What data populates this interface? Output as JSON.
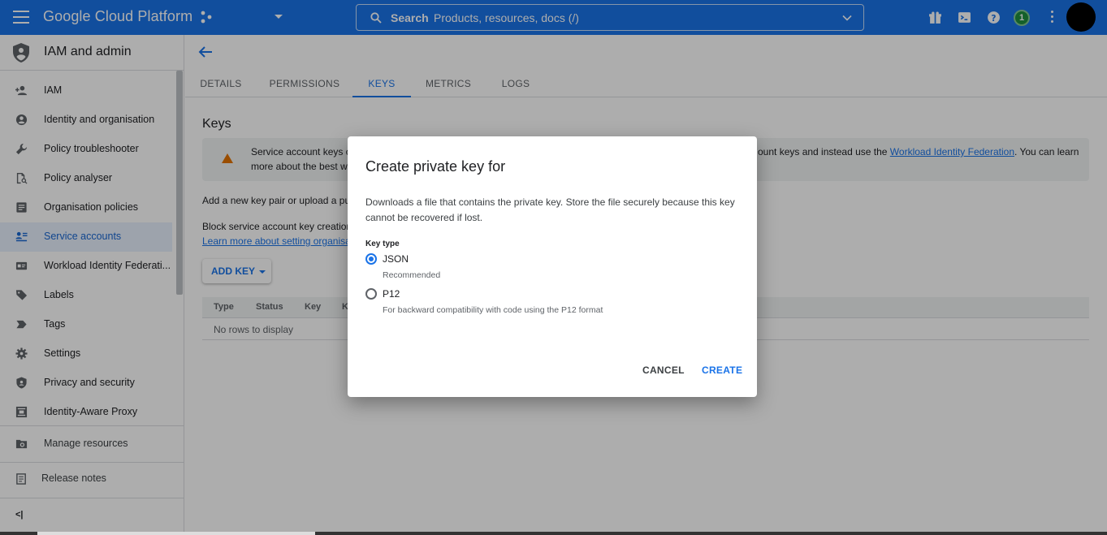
{
  "topbar": {
    "brand": "Google Cloud Platform",
    "search_label": "Search",
    "search_placeholder": "Products, resources, docs (/)",
    "notification_count": "1",
    "color": "#1a73e8"
  },
  "sidebar": {
    "title": "IAM and admin",
    "items": [
      {
        "label": "IAM",
        "icon": "person-add-icon"
      },
      {
        "label": "Identity and organisation",
        "icon": "account-circle-icon"
      },
      {
        "label": "Policy troubleshooter",
        "icon": "wrench-icon"
      },
      {
        "label": "Policy analyser",
        "icon": "document-search-icon"
      },
      {
        "label": "Organisation policies",
        "icon": "list-box-icon"
      },
      {
        "label": "Service accounts",
        "icon": "service-account-icon",
        "active": true
      },
      {
        "label": "Workload Identity Federati...",
        "icon": "id-card-icon"
      },
      {
        "label": "Labels",
        "icon": "label-icon"
      },
      {
        "label": "Tags",
        "icon": "tag-chevron-icon"
      },
      {
        "label": "Settings",
        "icon": "gear-icon"
      },
      {
        "label": "Privacy and security",
        "icon": "shield-icon"
      },
      {
        "label": "Identity-Aware Proxy",
        "icon": "proxy-icon"
      }
    ],
    "manage_resources": "Manage resources",
    "release_notes": "Release notes",
    "collapse": "<|"
  },
  "main": {
    "tabs": [
      {
        "label": "DETAILS"
      },
      {
        "label": "PERMISSIONS"
      },
      {
        "label": "KEYS",
        "active": true
      },
      {
        "label": "METRICS"
      },
      {
        "label": "LOGS"
      }
    ],
    "heading": "Keys",
    "warning_line1": "Service account keys c",
    "warning_line2": "more about the best wa",
    "warning_right_prefix": "ount keys and instead use the",
    "warning_link": "Workload Identity Federation",
    "warning_right_suffix": ". You can learn",
    "add_key_text": "Add a new key pair or upload a pub",
    "block_text": "Block service account key creation",
    "learn_link": "Learn more about setting organisa",
    "add_key_button": "ADD KEY",
    "table_headers": [
      "Type",
      "Status",
      "Key",
      "K"
    ],
    "empty_text": "No rows to display"
  },
  "dialog": {
    "title": "Create private key for",
    "description": "Downloads a file that contains the private key. Store the file securely because this key cannot be recovered if lost.",
    "key_type_label": "Key type",
    "options": [
      {
        "label": "JSON",
        "sub": "Recommended",
        "checked": true
      },
      {
        "label": "P12",
        "sub": "For backward compatibility with code using the P12 format",
        "checked": false
      }
    ],
    "cancel": "CANCEL",
    "create": "CREATE"
  }
}
